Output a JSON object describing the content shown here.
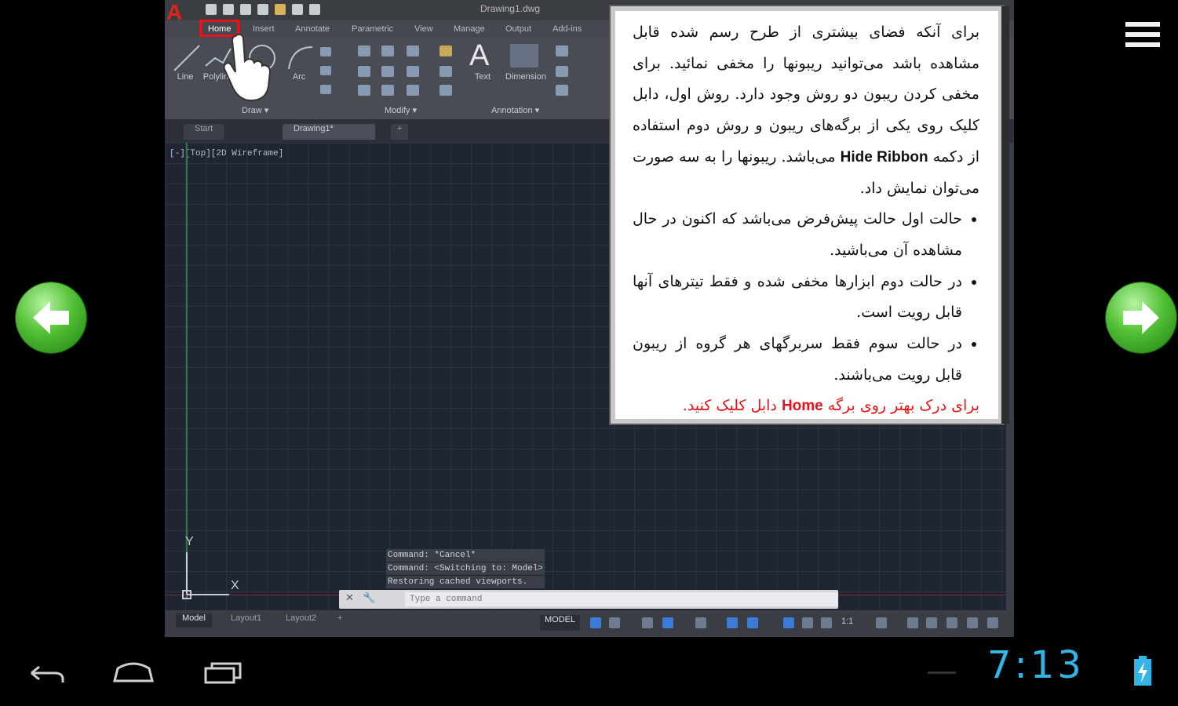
{
  "cad": {
    "title_file": "Drawing1.dwg",
    "ribbon_tabs": [
      "Home",
      "Insert",
      "Annotate",
      "Parametric",
      "View",
      "Manage",
      "Output",
      "Add-ins"
    ],
    "draw_tools": [
      "Line",
      "Polyline",
      "Circle",
      "Arc"
    ],
    "annotation_tools": [
      "Text",
      "Dimension"
    ],
    "panel_titles": {
      "draw": "Draw ▾",
      "modify": "Modify ▾",
      "annotation": "Annotation ▾"
    },
    "file_tabs": [
      "Start",
      "Drawing1*",
      "+"
    ],
    "viewport_label": "[-][Top][2D Wireframe]",
    "command_log": [
      "Command: *Cancel*",
      "Command:   <Switching to: Model>",
      "Restoring cached viewports."
    ],
    "command_placeholder": "Type a command",
    "layout_tabs": [
      "Model",
      "Layout1",
      "Layout2",
      "+"
    ],
    "status_model": "MODEL",
    "status_scale": "1:1",
    "axis_labels": {
      "y": "Y",
      "x": "X"
    }
  },
  "info": {
    "paragraph": "برای آنکه فضای بیشتری از طرح رسم شده قابل مشاهده باشد می‌توانید ریبونها را مخفی نمائید. برای مخفی کردن ریبون دو روش وجود دارد. روش اول، دابل کلیک روی یکی از برگه‌های ریبون و روش دوم استفاده از دکمه",
    "button_name": "Hide Ribbon",
    "paragraph_end": "می‌باشد.",
    "paragraph2": "ریبونها را به سه صورت می‌توان نمایش داد.",
    "bullets": [
      "حالت اول حالت پیش‌فرض می‌باشد که اکنون در حال مشاهده آن می‌باشید.",
      "در حالت دوم ابزارها مخفی شده و فقط تیترهای آنها قابل رویت است.",
      "در حالت سوم فقط سربرگهای هر گروه از ریبون قابل رویت می‌باشند."
    ],
    "hint_prefix": "برای درک بهتر روی برگه",
    "hint_word": "Home",
    "hint_suffix": "دابل کلیک کنید."
  },
  "system": {
    "clock": "7:13"
  },
  "colors": {
    "highlight_red": "#e8141a",
    "clock_blue": "#33b5e5",
    "nav_green": "#52c035"
  },
  "icons": {
    "prev": "arrow-left-icon",
    "next": "arrow-right-icon",
    "menu": "hamburger-menu-icon",
    "back": "back-icon",
    "home": "home-icon",
    "recents": "recent-apps-icon",
    "battery": "battery-charging-icon"
  }
}
